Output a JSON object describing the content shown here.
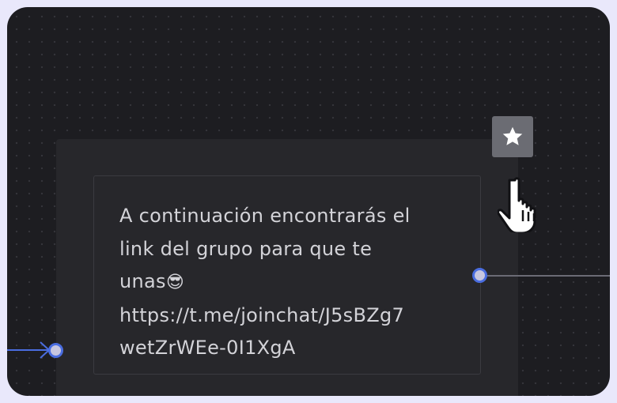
{
  "node": {
    "message_lines": [
      "A continuación encontrarás el",
      "link del grupo para que te",
      "unas"
    ],
    "emoji": "😎",
    "link_lines": [
      "https://t.me/joinchat/J5sBZg7",
      "wetZrWEe-0I1XgA"
    ]
  },
  "toolbar": {
    "star_icon": "star-icon"
  },
  "colors": {
    "canvas": "#1d1d21",
    "node": "#27272b",
    "connector": "#4a6de0",
    "outgoing_line": "#6b6b75",
    "frame": "#e9e8fb"
  }
}
